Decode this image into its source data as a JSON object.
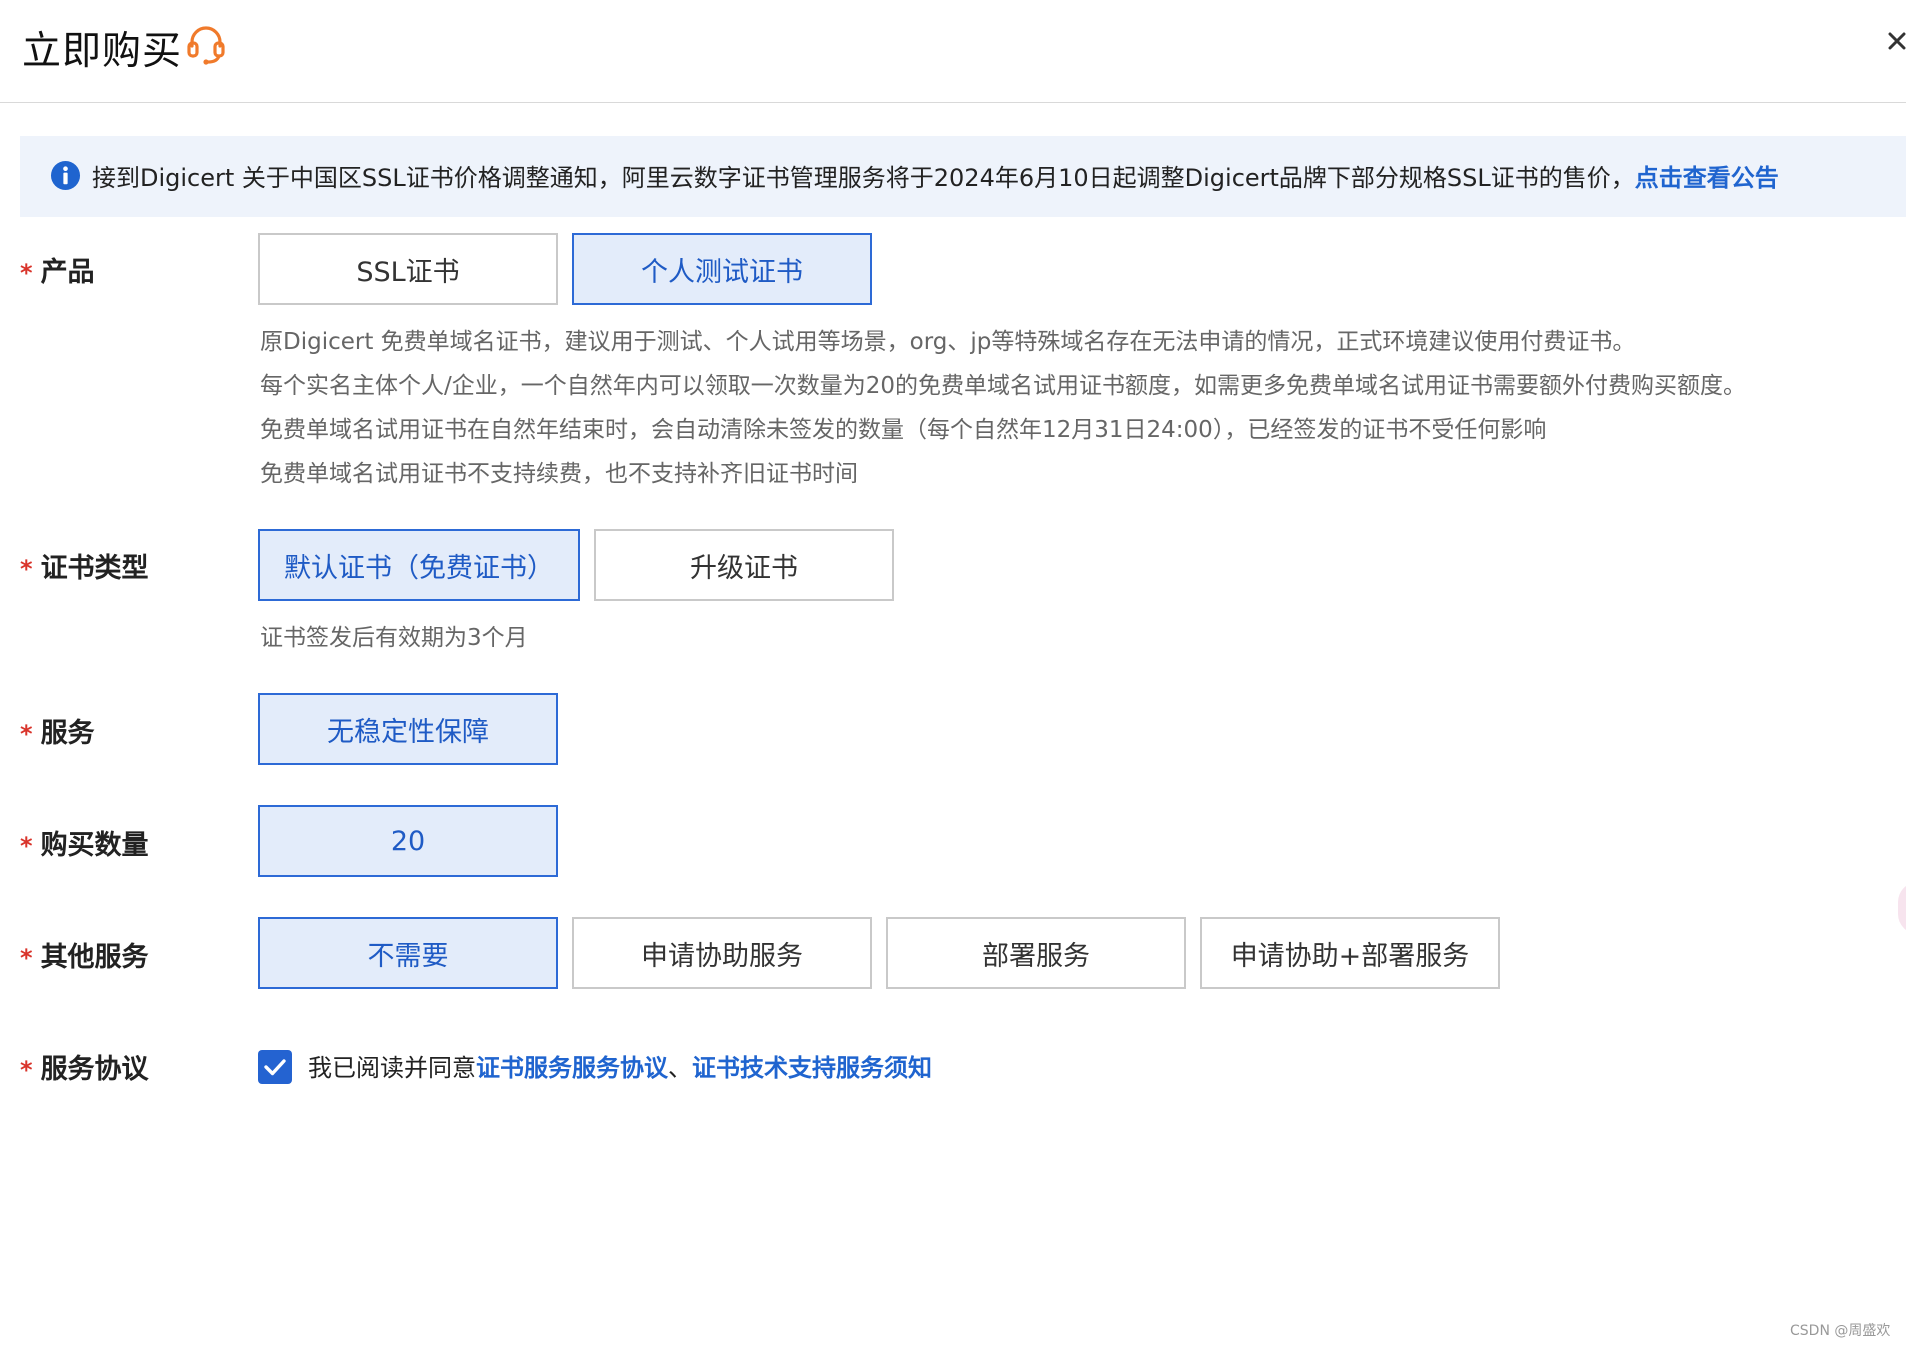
{
  "dialog": {
    "title": "立即购买"
  },
  "notice": {
    "text": "接到Digicert 关于中国区SSL证书价格调整通知，阿里云数字证书管理服务将于2024年6月10日起调整Digicert品牌下部分规格SSL证书的售价，",
    "link": "点击查看公告"
  },
  "form": {
    "required_mark": "*",
    "product": {
      "label": "产品",
      "options": [
        "SSL证书",
        "个人测试证书"
      ],
      "selected": "个人测试证书",
      "desc": [
        "原Digicert 免费单域名证书，建议用于测试、个人试用等场景，org、jp等特殊域名存在无法申请的情况，正式环境建议使用付费证书。",
        "每个实名主体个人/企业，一个自然年内可以领取一次数量为20的免费单域名试用证书额度，如需更多免费单域名试用证书需要额外付费购买额度。",
        "免费单域名试用证书在自然年结束时，会自动清除未签发的数量（每个自然年12月31日24:00），已经签发的证书不受任何影响",
        "免费单域名试用证书不支持续费，也不支持补齐旧证书时间"
      ]
    },
    "cert_type": {
      "label": "证书类型",
      "options": [
        "默认证书（免费证书）",
        "升级证书"
      ],
      "selected": "默认证书（免费证书）",
      "desc": "证书签发后有效期为3个月"
    },
    "service": {
      "label": "服务",
      "options": [
        "无稳定性保障"
      ],
      "selected": "无稳定性保障"
    },
    "quantity": {
      "label": "购买数量",
      "value": "20"
    },
    "other_services": {
      "label": "其他服务",
      "options": [
        "不需要",
        "申请协助服务",
        "部署服务",
        "申请协助+部署服务"
      ],
      "selected": "不需要"
    },
    "agreement": {
      "label": "服务协议",
      "checked": true,
      "text_prefix": "我已阅读并同意",
      "link1": "证书服务服务协议",
      "separator": "、",
      "link2": "证书技术支持服务须知"
    }
  },
  "colors": {
    "accent": "#2d6ad6",
    "selected_bg": "#e3ecfa",
    "required": "#d9342b",
    "support_icon": "#f07a2b",
    "notice_bg": "#eef3fb"
  },
  "icons": {
    "support": "headset-icon",
    "close": "close-icon",
    "notice": "info-icon",
    "check": "check-icon"
  },
  "watermark": "CSDN @周盛欢"
}
